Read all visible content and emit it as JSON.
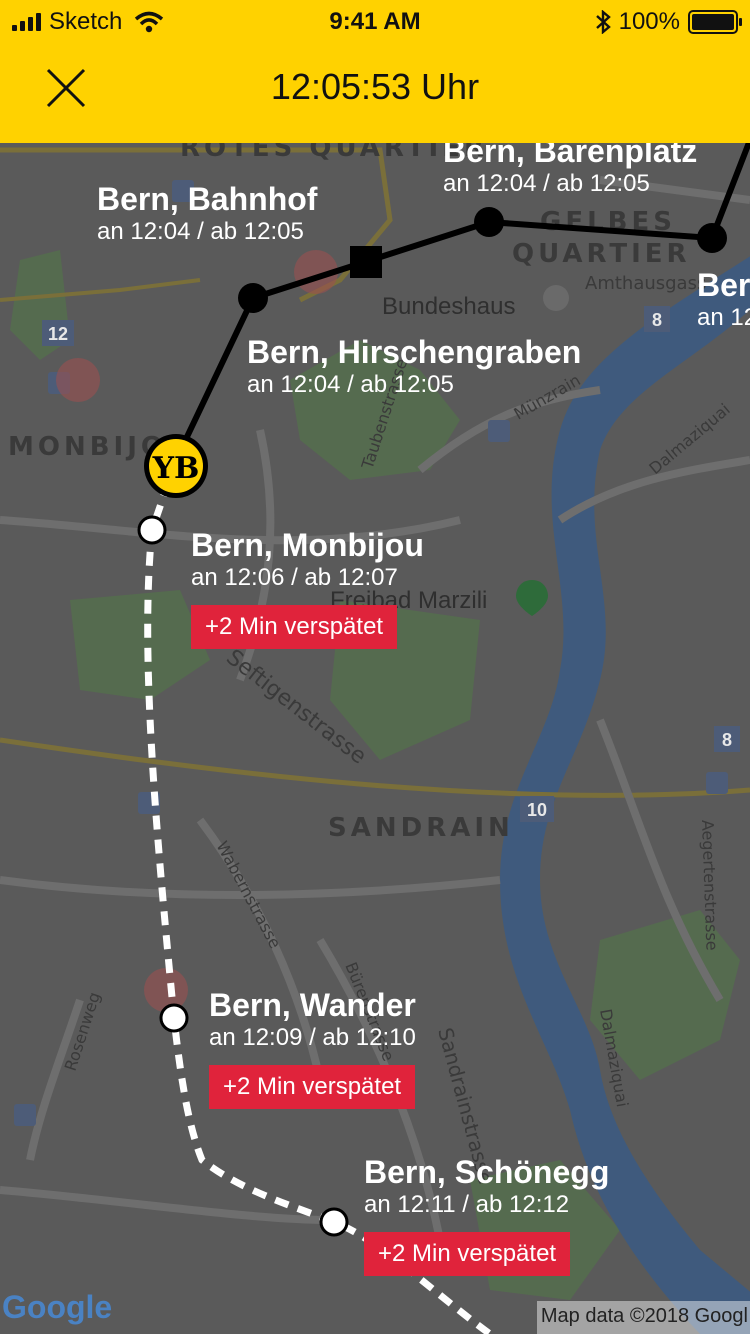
{
  "status_bar": {
    "carrier": "Sketch",
    "time": "9:41 AM",
    "battery": "100%"
  },
  "header": {
    "title": "12:05:53 Uhr",
    "close_icon": "close-icon",
    "background": "#FFD200"
  },
  "map": {
    "districts": [
      "ROTES QUARTIER",
      "GELBES",
      "QUARTIER",
      "MONBIJOU",
      "SANDRAIN"
    ],
    "streets": [
      "Amthausgass",
      "Taubenstrasse",
      "Münzrain",
      "Dalmaziquai",
      "Dalmaziquai",
      "Aegertenstrasse",
      "Wabernstrasse",
      "Bürenstrasse",
      "Sandrainstrasse",
      "Rosenweg",
      "Seftigenstrasse"
    ],
    "pois": [
      "Bundeshaus",
      "Freibad Marzili"
    ],
    "badges": [
      "12",
      "8",
      "8",
      "10"
    ],
    "team_logo": "YB",
    "attribution_logo": "Google",
    "attribution": "Map data ©2018 Googl"
  },
  "stops": [
    {
      "name": "Bern, Bärenplatz",
      "times": "an 12:04 / ab 12:05"
    },
    {
      "name": "Bern, Bahnhof",
      "times": "an 12:04 / ab 12:05"
    },
    {
      "name": "Bern",
      "times": "an 12"
    },
    {
      "name": "Bern, Hirschengraben",
      "times": "an 12:04 / ab 12:05"
    },
    {
      "name": "Bern, Monbijou",
      "times": "an 12:06 / ab 12:07",
      "delay": "+2 Min verspätet"
    },
    {
      "name": "Bern, Wander",
      "times": "an 12:09 / ab 12:10",
      "delay": "+2 Min verspätet"
    },
    {
      "name": "Bern, Schönegg",
      "times": "an 12:11 / ab 12:12",
      "delay": "+2 Min verspätet"
    }
  ],
  "colors": {
    "delay": "#E0233B",
    "route_past": "#000000",
    "route_future": "#FFFFFF",
    "logo": "#FFD200"
  }
}
